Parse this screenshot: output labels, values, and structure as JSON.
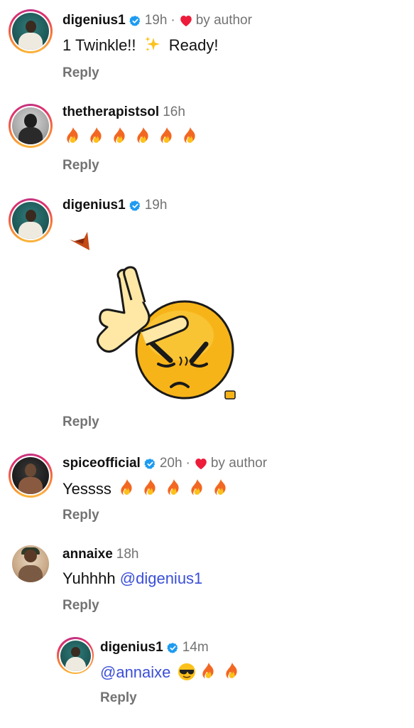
{
  "comments": [
    {
      "username": "digenius1",
      "time": "19h",
      "sep": "·",
      "liked_by": "by author",
      "text": "1 Twinkle!!",
      "text_after": "Ready!",
      "reply_label": "Reply"
    },
    {
      "username": "thetherapistsol",
      "time": "16h",
      "reply_label": "Reply",
      "fire_count": 6
    },
    {
      "username": "digenius1",
      "time": "19h",
      "reply_label": "Reply",
      "sticker": "loser-hand-emoji-sticker"
    },
    {
      "username": "spiceofficial",
      "time": "20h",
      "sep": "·",
      "liked_by": "by author",
      "text": "Yessss",
      "reply_label": "Reply",
      "fire_count": 5
    },
    {
      "username": "annaixe",
      "time": "18h",
      "text": "Yuhhhh",
      "mention": "@digenius1",
      "reply_label": "Reply"
    },
    {
      "username": "digenius1",
      "time": "14m",
      "mention": "@annaixe",
      "reply_label": "Reply",
      "fire_count": 2
    }
  ],
  "colors": {
    "verified": "#1d9bf0",
    "heart": "#ed1c3a",
    "mention": "#3a4fd8",
    "muted": "#737373"
  }
}
